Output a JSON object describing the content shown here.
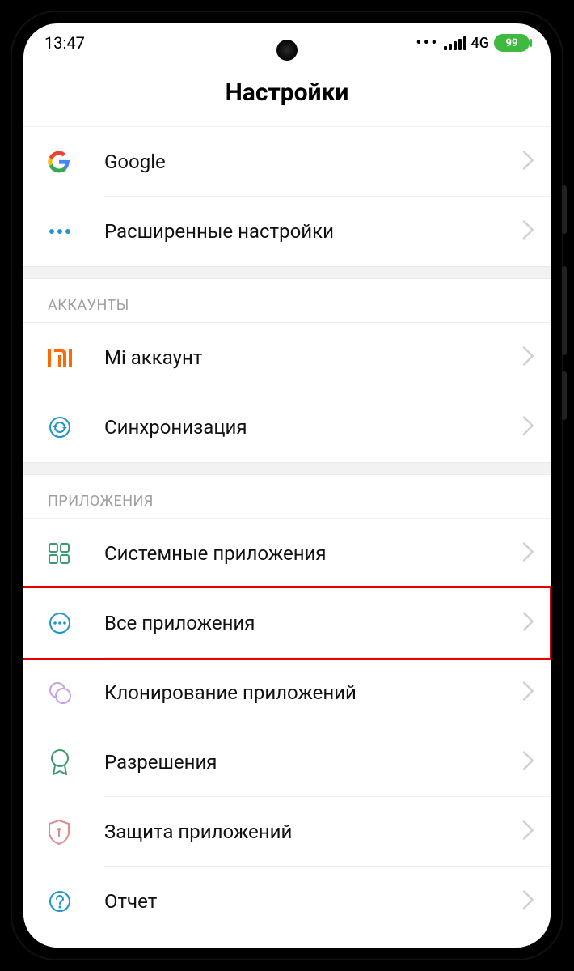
{
  "status": {
    "time": "13:47",
    "network": "4G",
    "battery": "99"
  },
  "title": "Настройки",
  "sections": [
    {
      "header": null,
      "items": [
        {
          "id": "google",
          "label": "Google",
          "icon": "google-icon"
        },
        {
          "id": "advanced",
          "label": "Расширенные настройки",
          "icon": "more-icon"
        }
      ]
    },
    {
      "header": "АККАУНТЫ",
      "items": [
        {
          "id": "mi-account",
          "label": "Mi аккаунт",
          "icon": "mi-icon"
        },
        {
          "id": "sync",
          "label": "Синхронизация",
          "icon": "sync-icon"
        }
      ]
    },
    {
      "header": "ПРИЛОЖЕНИЯ",
      "items": [
        {
          "id": "system-apps",
          "label": "Системные приложения",
          "icon": "grid-icon"
        },
        {
          "id": "all-apps",
          "label": "Все приложения",
          "icon": "circle-more-icon",
          "highlighted": true
        },
        {
          "id": "clone-apps",
          "label": "Клонирование приложений",
          "icon": "clone-icon"
        },
        {
          "id": "permissions",
          "label": "Разрешения",
          "icon": "badge-icon"
        },
        {
          "id": "app-protect",
          "label": "Защита приложений",
          "icon": "shield-icon"
        },
        {
          "id": "report",
          "label": "Отчет",
          "icon": "question-icon"
        }
      ]
    }
  ]
}
